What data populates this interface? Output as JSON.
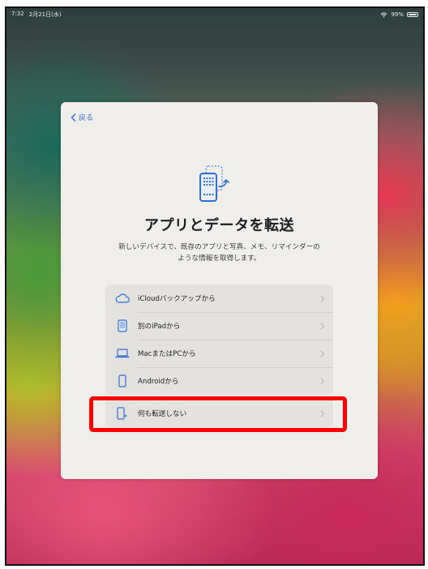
{
  "status_bar": {
    "time": "7:32",
    "date": "2月21日(水)",
    "battery": "99%"
  },
  "card": {
    "back_label": "戻る",
    "title": "アプリとデータを転送",
    "description": "新しいデバイスで、既存のアプリと写真、メモ、リマインダーのような情報を取得します。",
    "options": [
      {
        "label": "iCloudバックアップから",
        "icon": "cloud-icon"
      },
      {
        "label": "別のiPadから",
        "icon": "ipad-icon"
      },
      {
        "label": "MacまたはPCから",
        "icon": "laptop-icon"
      },
      {
        "label": "Androidから",
        "icon": "android-phone-icon"
      }
    ],
    "no_transfer_option": {
      "label": "何も転送しない",
      "icon": "sparkle-phone-icon"
    }
  },
  "colors": {
    "accent": "#2f6fd8",
    "highlight": "#ff0000",
    "card_bg": "#efeeeb"
  }
}
